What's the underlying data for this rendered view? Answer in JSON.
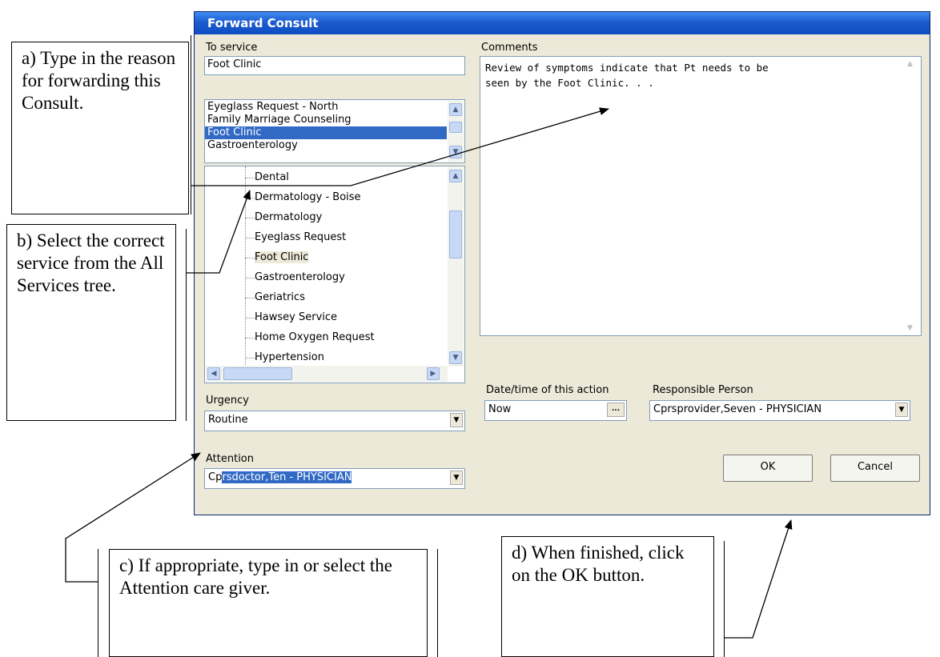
{
  "dialog": {
    "title": "Forward Consult",
    "to_service_label": "To service",
    "to_service_value": "Foot Clinic",
    "service_list": [
      "Eyeglass Request - North",
      "Family Marriage Counseling",
      "Foot Clinic",
      "Gastroenterology"
    ],
    "service_tree": [
      "Dental",
      "Dermatology - Boise",
      "Dermatology",
      "Eyeglass Request",
      "Foot Clinic",
      "Gastroenterology",
      "Geriatrics",
      "Hawsey Service",
      "Home Oxygen Request",
      "Hypertension"
    ],
    "comments_label": "Comments",
    "comments_text": "Review of symptoms indicate that Pt needs to be\nseen by the Foot Clinic. . .",
    "urgency_label": "Urgency",
    "urgency_value": "Routine",
    "attention_label": "Attention",
    "attention_value_prefix": "Cp",
    "attention_value_selected": "rsdoctor,Ten - PHYSICIAN",
    "datetime_label": "Date/time of this action",
    "datetime_value": "Now",
    "datetime_button": "...",
    "responsible_label": "Responsible Person",
    "responsible_value": "Cprsprovider,Seven - PHYSICIAN",
    "ok_label": "OK",
    "cancel_label": "Cancel",
    "selection_color": "#316ac5"
  },
  "callouts": {
    "a": "a) Type in the reason for forwarding this Consult.",
    "b": "b) Select the correct service from the All Services tree.",
    "c": "c) If appropriate, type in or select the Attention care giver.",
    "d": "d) When finished, click on the OK button."
  }
}
